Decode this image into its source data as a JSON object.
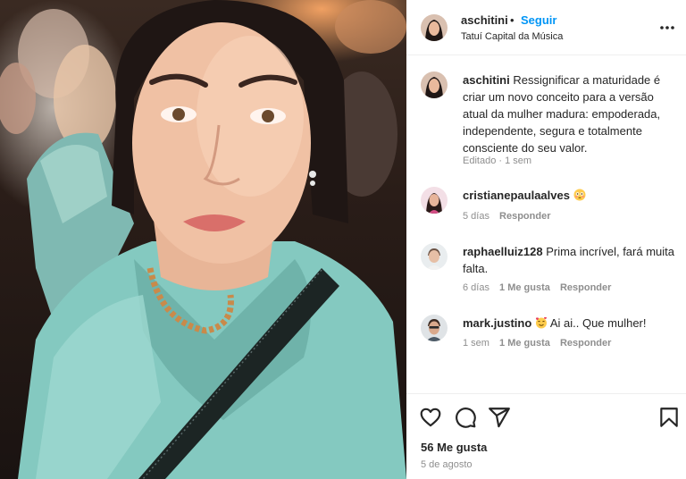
{
  "post": {
    "author": "aschitini",
    "separator": "•",
    "follow_label": "Seguir",
    "location": "Tatuí Capital da Música",
    "more_icon": "more-horizontal-icon"
  },
  "caption": {
    "author": "aschitini",
    "text": "Ressignificar a maturidade é criar um novo conceito para a versão atual da mulher madura: empoderada, independente, segura e totalmente consciente do seu valor.",
    "time": "Editado · 1 sem"
  },
  "comments": [
    {
      "user": "cristianepaulaalves",
      "text": "",
      "emoji": "flushed-face-emoji",
      "time": "5 días",
      "likes": "",
      "reply": "Responder"
    },
    {
      "user": "raphaelluiz128",
      "text": "Prima incrível, fará muita falta.",
      "emoji": "",
      "time": "6 días",
      "likes": "1 Me gusta",
      "reply": "Responder"
    },
    {
      "user": "mark.justino",
      "text": "Ai ai.. Que mulher!",
      "emoji": "smiling-face-with-hearts-emoji",
      "time": "1 sem",
      "likes": "1 Me gusta",
      "reply": "Responder"
    }
  ],
  "actions": {
    "icons": [
      "heart-icon",
      "comment-icon",
      "share-icon",
      "bookmark-icon"
    ],
    "likes": "56 Me gusta",
    "date": "5 de agosto"
  },
  "colors": {
    "accent": "#0095f6",
    "text": "#262626",
    "muted": "#8e8e8e",
    "divider": "#efefef"
  }
}
